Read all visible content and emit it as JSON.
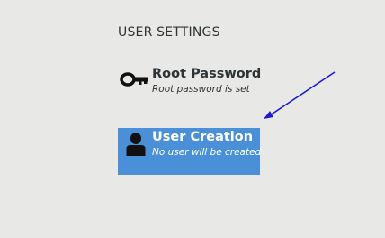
{
  "section": {
    "title": "USER SETTINGS"
  },
  "spokes": [
    {
      "name": "Root Password",
      "status": "Root password is set",
      "icon": "key-icon",
      "selected": false
    },
    {
      "name": "User Creation",
      "status": "No user will be created",
      "icon": "person-icon",
      "selected": true
    }
  ],
  "colors": {
    "background": "#e8e8e7",
    "selected_bg": "#4a90d9",
    "annotation_arrow": "#1a1ad6"
  }
}
